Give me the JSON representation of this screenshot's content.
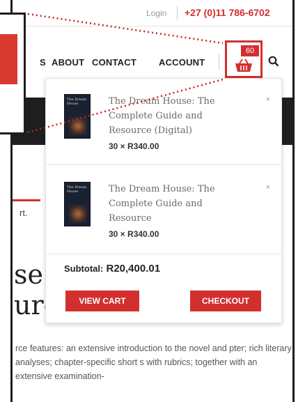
{
  "header": {
    "login_label": "Login",
    "phone": "+27 (0)11 786-6702"
  },
  "nav": {
    "items": [
      {
        "label": "S"
      },
      {
        "label": "ABOUT"
      },
      {
        "label": "CONTACT"
      },
      {
        "label": "ACCOUNT"
      }
    ],
    "cart_count": "60",
    "cart_icon": "basket-icon",
    "search_icon": "search-icon"
  },
  "cart_dropdown": {
    "items": [
      {
        "title": "The Dream House: The Complete Guide and Resource (Digital)",
        "qty_price": "30 × R340.00",
        "thumb_label": "The Dream House",
        "remove_label": "×"
      },
      {
        "title": "The Dream House: The Complete Guide and Resource",
        "qty_price": "30 × R340.00",
        "thumb_label": "The Dream House",
        "remove_label": "×"
      }
    ],
    "subtotal_label": "Subtotal:",
    "subtotal_value": "R20,400.01",
    "view_cart_label": "VIEW CART",
    "checkout_label": "CHECKOUT"
  },
  "content": {
    "breadcrumb_fragment": "rt.",
    "title_line1": "se:",
    "title_line2": "urc",
    "body_text": "rce features: an extensive introduction to the novel and pter; rich literary analyses; chapter-specific short s with rubrics; together with an extensive examination-"
  },
  "colors": {
    "accent": "#d32f2f",
    "dark": "#1e1e1e"
  }
}
